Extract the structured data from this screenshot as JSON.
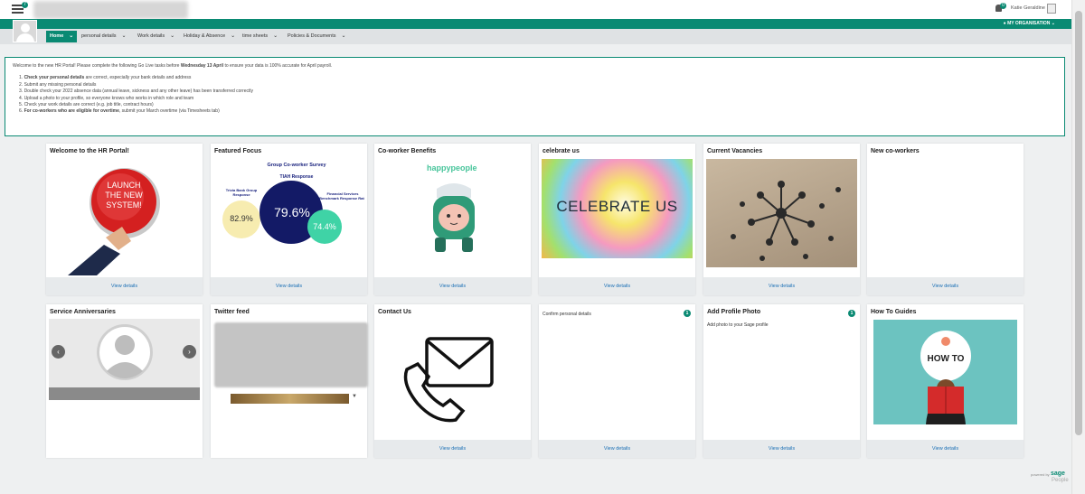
{
  "header": {
    "notification_count": "7",
    "bell_count": "0",
    "user_name": "Katie Geraldine",
    "my_org_label": "MY ORGANISATION"
  },
  "nav": {
    "items": [
      {
        "label": "Home"
      },
      {
        "label": "personal details"
      },
      {
        "label": "Work details"
      },
      {
        "label": "Holiday & Absence"
      },
      {
        "label": "time sheets"
      },
      {
        "label": "Policies & Documents"
      }
    ],
    "chevron": "⌄"
  },
  "announcement": {
    "intro_1": "Welcome to the new HR Portal! Please complete the following Go Live tasks before ",
    "intro_date": "Wednesday 13 April",
    "intro_2": " to ensure your data is 100% accurate for April payroll.",
    "items": [
      {
        "num": "1. ",
        "bold": "Check your personal details",
        "rest": " are correct, especially your bank details and address"
      },
      {
        "num": "2. ",
        "bold": "",
        "rest": "Submit any missing personal details"
      },
      {
        "num": "3. ",
        "bold": "",
        "rest": "Double check your 2022 absence data (annual leave, sickness and any other leave) has been transferred correctly"
      },
      {
        "num": "4. ",
        "bold": "",
        "rest": "Upload a photo to your profile, so everyone knows who works in which role and team"
      },
      {
        "num": "5. ",
        "bold": "",
        "rest": "Check your work details are correct (e.g. job title, contract hours)"
      },
      {
        "num": "6. ",
        "bold": "For co-workers who are eligible for overtime",
        "rest": ", submit your March overtime (via Timesheets tab)"
      }
    ]
  },
  "cards_row1": [
    {
      "title": "Welcome to the HR Portal!",
      "link": "View details"
    },
    {
      "title": "Featured Focus",
      "link": "View details"
    },
    {
      "title": "Co-worker Benefits",
      "link": "View details"
    },
    {
      "title": "celebrate us",
      "link": "View details"
    },
    {
      "title": "Current Vacancies",
      "link": "View details"
    },
    {
      "title": "New co-workers",
      "link": "View details"
    }
  ],
  "cards_row2": [
    {
      "title": "Service Anniversaries"
    },
    {
      "title": "Twitter feed"
    },
    {
      "title": "Contact Us",
      "link": "View details"
    },
    {
      "title": "",
      "text": "Confirm personal details",
      "count": "1",
      "link": "View details"
    },
    {
      "title": "Add Profile Photo",
      "text": "Add photo to your Sage profile",
      "count": "1",
      "link": "View details"
    },
    {
      "title": "How To Guides",
      "link": "View details"
    }
  ],
  "launch_button": {
    "line1": "LAUNCH",
    "line2": "THE NEW",
    "line3": "SYSTEM!"
  },
  "survey": {
    "title": "Group Co-worker Survey",
    "subtitle": "TIAH Response",
    "left_label": "Trivia Bank Group Response",
    "left_value": "82.9%",
    "main_value": "79.6%",
    "right_label": "Financial Services Benchmark Response Rate",
    "right_value": "74.4%"
  },
  "benefits": {
    "brand": "happypeople"
  },
  "celebrate": {
    "text": "CELEBRATE US"
  },
  "howto": {
    "text": "HOW TO"
  },
  "footer": {
    "powered": "powered by",
    "brand": "sage",
    "sub": "People"
  },
  "colors": {
    "accent": "#0a8a73",
    "link": "#1a6fb5"
  }
}
